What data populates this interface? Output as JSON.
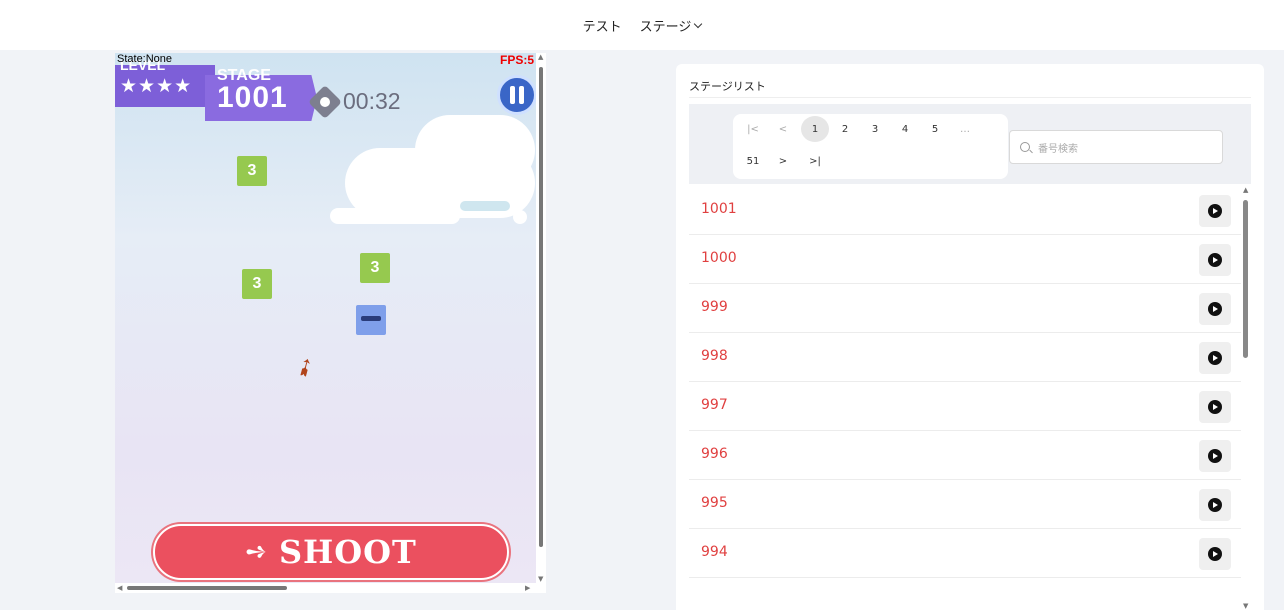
{
  "nav": {
    "item1": "テスト",
    "item2": "ステージ"
  },
  "game": {
    "state": "State:None",
    "fps": "FPS:5",
    "level_label": "LEVEL",
    "stars": "★★★★",
    "stage_label": "STAGE",
    "stage_number": "1001",
    "timer": "00:32",
    "blocks": [
      "3",
      "3",
      "3"
    ],
    "shoot_label": "SHOOT"
  },
  "panel": {
    "title": "ステージリスト",
    "pagination": {
      "first": "|<",
      "prev": "<",
      "pages": [
        "1",
        "2",
        "3",
        "4",
        "5"
      ],
      "ellipsis": "…",
      "last_page": "51",
      "next": ">",
      "last": ">|"
    },
    "search_placeholder": "番号検索",
    "stages": [
      "1001",
      "1000",
      "999",
      "998",
      "997",
      "996",
      "995",
      "994"
    ]
  },
  "colors": {
    "accent_red": "#e04040",
    "purple": "#7d5fd8",
    "shoot": "#eb505f"
  }
}
